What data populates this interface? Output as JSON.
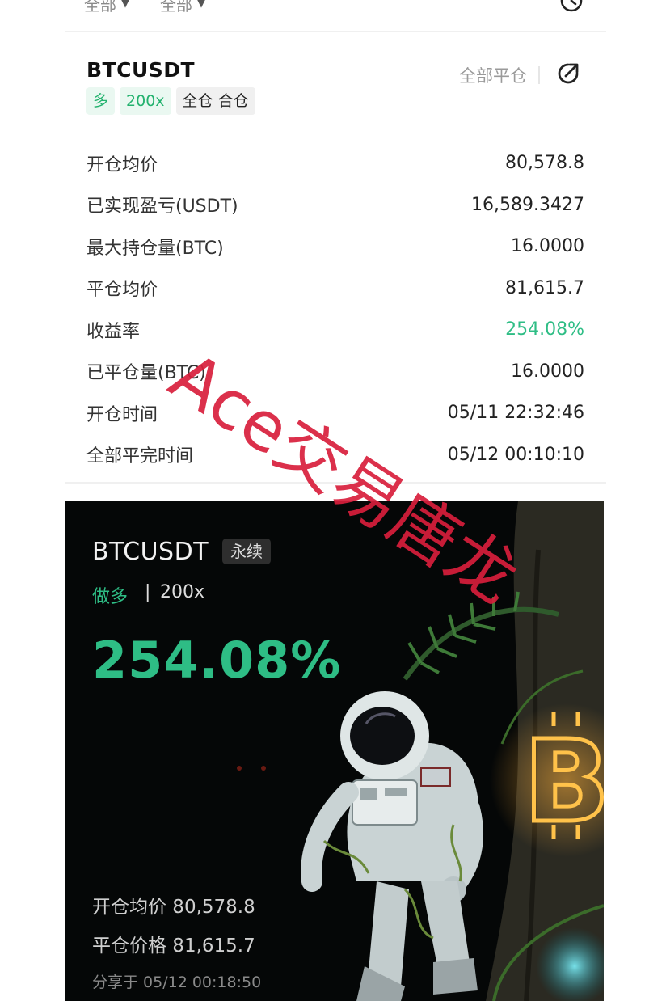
{
  "filters": [
    {
      "label": "全部"
    },
    {
      "label": "全部"
    }
  ],
  "position": {
    "symbol": "BTCUSDT",
    "side_tag": "多",
    "leverage_tag": "200x",
    "mode_tag": "全仓 合仓",
    "close_all_label": "全部平仓",
    "rows": [
      {
        "label": "开仓均价",
        "value": "80,578.8"
      },
      {
        "label": "已实现盈亏(USDT)",
        "value": "16,589.3427"
      },
      {
        "label": "最大持仓量(BTC)",
        "value": "16.0000"
      },
      {
        "label": "平仓均价",
        "value": "81,615.7"
      },
      {
        "label": "收益率",
        "value": "254.08%"
      },
      {
        "label": "已平仓量(BTC)",
        "value": "16.0000"
      },
      {
        "label": "开仓时间",
        "value": "05/11 22:32:46"
      },
      {
        "label": "全部平完时间",
        "value": "05/12 00:10:10"
      }
    ]
  },
  "poster": {
    "symbol": "BTCUSDT",
    "badge": "永续",
    "side": "做多",
    "separator": "|",
    "leverage": "200x",
    "roi": "254.08%",
    "open_price_line": "开仓均价 80,578.8",
    "close_price_line": "平仓价格 81,615.7",
    "share_line": "分享于 05/12 00:18:50"
  },
  "watermark": {
    "text": "Ace交易唐龙"
  },
  "colors": {
    "positive": "#2ebd85",
    "watermark": "#d81e3c",
    "poster_bg": "#050707"
  }
}
